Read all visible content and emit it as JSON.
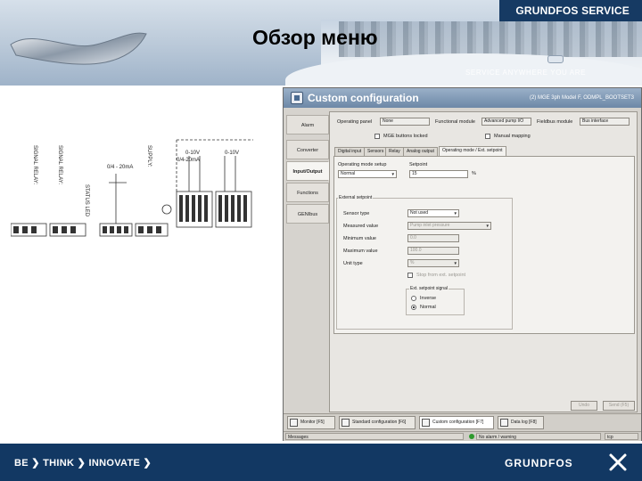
{
  "header": {
    "brand": "GRUNDFOS SERVICE",
    "title": "Обзор меню",
    "tagline": "SERVICE ANYWHERE YOU ARE"
  },
  "window": {
    "title": "Custom configuration",
    "device": "(2) MGE 3ph Model F, ODMPL_BOOTSET3",
    "nav": [
      "Alarm",
      "Converter",
      "Input/Output",
      "Functions",
      "GENIbus"
    ],
    "active_nav": "Input/Output",
    "top_fields": {
      "operating_panel_label": "Operating panel",
      "operating_panel_value": "None",
      "functional_module_label": "Functional module",
      "functional_module_value": "Advanced pump I/O",
      "fieldbus_module_label": "Fieldbus module",
      "fieldbus_module_value": "Bus interface",
      "mge_buttons_locked": "MGE buttons locked",
      "manual_mapping": "Manual mapping"
    },
    "tabs": [
      "Digital input",
      "Sensors",
      "Relay",
      "Analog output",
      "Operating mode / Ext. setpoint"
    ],
    "active_tab": "Operating mode / Ext. setpoint",
    "panel": {
      "operating_mode_setup_label": "Operating mode setup",
      "operating_mode_setup_value": "Normal",
      "setpoint_label": "Setpoint",
      "setpoint_value": "15",
      "setpoint_unit": "%",
      "external_setpoint_group": "External setpoint",
      "sensor_type_label": "Sensor type",
      "sensor_type_value": "Not used",
      "measured_value_label": "Measured value",
      "measured_value_value": "Pump inlet pressure",
      "minimum_value_label": "Minimum value",
      "minimum_value_value": "0.0",
      "maximum_value_label": "Maximum value",
      "maximum_value_value": "100.0",
      "unit_type_label": "Unit type",
      "unit_type_value": "%",
      "stop_from_ext_setpoint": "Stop from ext. setpoint",
      "ext_signal_group": "Ext. setpoint signal",
      "radio_inverse": "Inverse",
      "radio_normal": "Normal"
    },
    "buttons": {
      "undo": "Undo",
      "send": "Send (F5)"
    },
    "bottom_tabs": [
      "Monitor [F5]",
      "Standard configuration [F6]",
      "Custom configuration [F7]",
      "Data log [F8]"
    ],
    "status": {
      "messages": "Messages",
      "alarm": "No alarm / warning",
      "corner": "tcp"
    }
  },
  "wiring": {
    "labels": [
      "SIGNAL RELAY:",
      "SIGNAL RELAY:",
      "STATUS LED",
      "SUPPLY:",
      "0/4 - 20mA",
      "0-10V",
      "0/4-20mA",
      "0-10V"
    ]
  },
  "footer": {
    "slogan_1": "BE",
    "slogan_2": "THINK",
    "slogan_3": "INNOVATE",
    "logo": "GRUNDFOS"
  },
  "colors": {
    "brand_blue": "#123863",
    "window_title": "#6d88a7",
    "status_ok": "#2e9a2e"
  }
}
